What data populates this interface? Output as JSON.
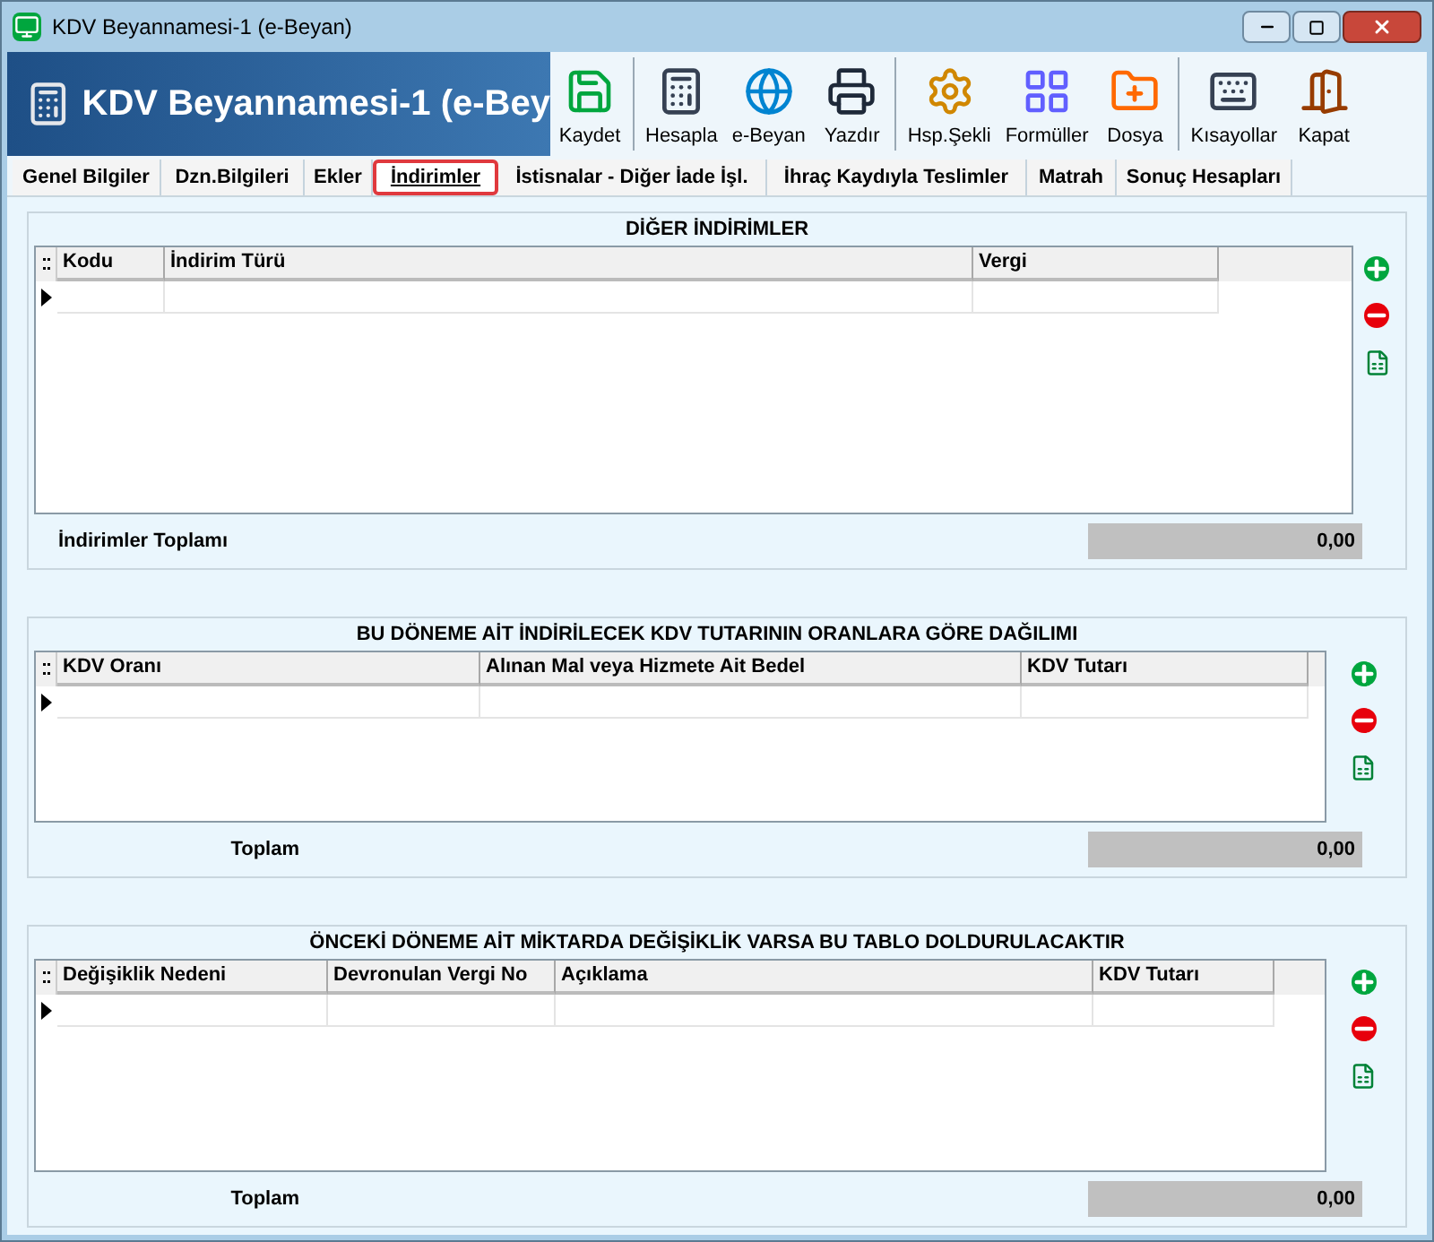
{
  "window": {
    "title": "KDV Beyannamesi-1 (e-Beyan)"
  },
  "header": {
    "title": "KDV Beyannamesi-1 (e-Bey"
  },
  "toolbar": [
    {
      "label": "Kaydet",
      "kind": "save"
    },
    {
      "label": "Hesapla",
      "kind": "calc"
    },
    {
      "label": "e-Beyan",
      "kind": "ebeyan"
    },
    {
      "label": "Yazdır",
      "kind": "print"
    },
    {
      "label": "Hsp.Şekli",
      "kind": "gear"
    },
    {
      "label": "Formüller",
      "kind": "formula"
    },
    {
      "label": "Dosya",
      "kind": "file"
    },
    {
      "label": "Kısayollar",
      "kind": "keyboard"
    },
    {
      "label": "Kapat",
      "kind": "exit"
    }
  ],
  "tabs": [
    {
      "label": "Genel Bilgiler",
      "selected": false
    },
    {
      "label": "Dzn.Bilgileri",
      "selected": false
    },
    {
      "label": "Ekler",
      "selected": false
    },
    {
      "label": "İndirimler",
      "selected": true
    },
    {
      "label": "İstisnalar - Diğer İade İşl.",
      "selected": false
    },
    {
      "label": "İhraç Kaydıyla Teslimler",
      "selected": false
    },
    {
      "label": "Matrah",
      "selected": false
    },
    {
      "label": "Sonuç Hesapları",
      "selected": false
    }
  ],
  "sections": [
    {
      "title": "DİĞER İNDİRİMLER",
      "columns": [
        "Kodu",
        "İndirim Türü",
        "Vergi"
      ],
      "total_label": "İndirimler Toplamı",
      "total_value": "0,00"
    },
    {
      "title": "BU DÖNEME AİT İNDİRİLECEK KDV TUTARININ ORANLARA GÖRE DAĞILIMI",
      "columns": [
        "KDV Oranı",
        "Alınan Mal veya Hizmete Ait Bedel",
        "KDV Tutarı"
      ],
      "total_label": "Toplam",
      "total_value": "0,00"
    },
    {
      "title": "ÖNCEKİ DÖNEME AİT MİKTARDA DEĞİŞİKLİK VARSA BU TABLO DOLDURULACAKTIR",
      "columns": [
        "Değişiklik Nedeni",
        "Devronulan Vergi No",
        "Açıklama",
        "KDV Tutarı"
      ],
      "total_label": "Toplam",
      "total_value": "0,00"
    }
  ]
}
